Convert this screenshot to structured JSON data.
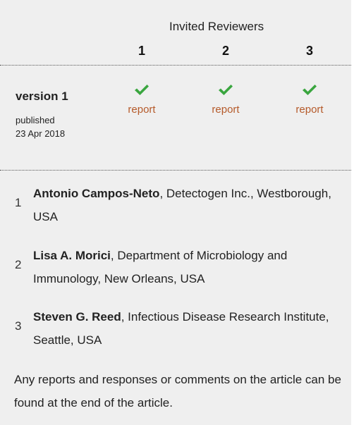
{
  "header": {
    "title": "Invited Reviewers",
    "columns": [
      "1",
      "2",
      "3"
    ]
  },
  "version": {
    "title": "version 1",
    "published_label": "published",
    "published_date": "23 Apr 2018",
    "reports": [
      {
        "label": "report",
        "status_icon": "check-icon"
      },
      {
        "label": "report",
        "status_icon": "check-icon"
      },
      {
        "label": "report",
        "status_icon": "check-icon"
      }
    ]
  },
  "reviewers": [
    {
      "number": "1",
      "name": "Antonio Campos-Neto",
      "affiliation": ", Detectogen Inc., Westborough, USA"
    },
    {
      "number": "2",
      "name": "Lisa A. Morici",
      "affiliation": ", Department of Microbiology and Immunology, New Orleans, USA"
    },
    {
      "number": "3",
      "name": "Steven G. Reed",
      "affiliation": ", Infectious Disease Research Institute, Seattle, USA"
    }
  ],
  "footer_note": "Any reports and responses or comments on the article can be found at the end of the article.",
  "colors": {
    "panel_bg": "#efefef",
    "check_green": "#3aa63f",
    "report_link": "#b55a2a"
  }
}
